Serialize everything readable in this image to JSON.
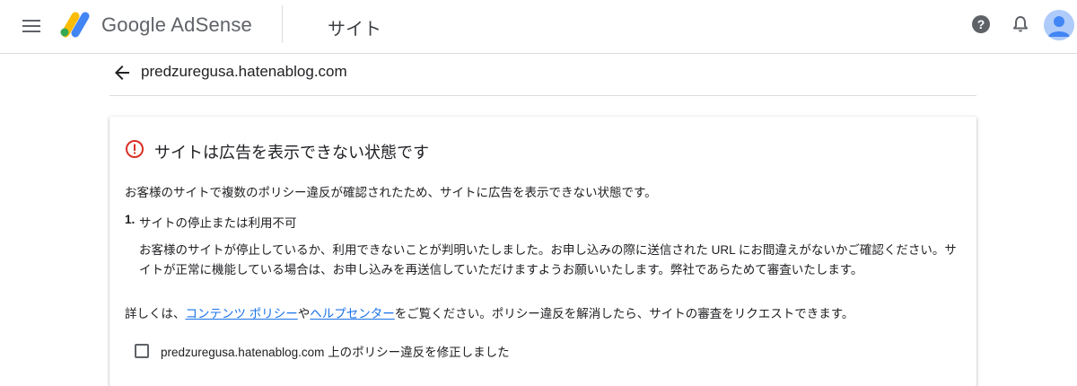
{
  "header": {
    "brand_google": "Google",
    "brand_product": "AdSense",
    "page_title": "サイト",
    "icons": {
      "menu": "menu-icon",
      "help": "help-icon",
      "notifications": "bell-icon",
      "account": "avatar-icon"
    }
  },
  "subheader": {
    "back_icon": "arrow-back-icon",
    "site": "predzuregusa.hatenablog.com"
  },
  "card": {
    "alert_icon": "error-icon",
    "title": "サイトは広告を表示できない状態です",
    "description": "お客様のサイトで複数のポリシー違反が確認されたため、サイトに広告を表示できない状態です。",
    "issues": [
      {
        "number": "1.",
        "title": "サイトの停止または利用不可",
        "body": "お客様のサイトが停止しているか、利用できないことが判明いたしました。お申し込みの際に送信された URL にお間違えがないかご確認ください。サイトが正常に機能している場合は、お申し込みを再送信していただけますようお願いいたします。弊社であらためて審査いたします。"
      }
    ],
    "more_info": {
      "prefix": "詳しくは、",
      "link1": "コンテンツ ポリシー",
      "connector": "や",
      "link2": "ヘルプセンター",
      "suffix": "をご覧ください。ポリシー違反を解消したら、サイトの審査をリクエストできます。"
    },
    "confirm_label": "predzuregusa.hatenablog.com 上のポリシー違反を修正しました",
    "confirm_checked": false
  },
  "colors": {
    "alert": "#d93025",
    "link": "#1a73e8",
    "logo_yellow": "#fbbc04",
    "logo_blue": "#4285f4",
    "logo_green": "#34a853"
  }
}
